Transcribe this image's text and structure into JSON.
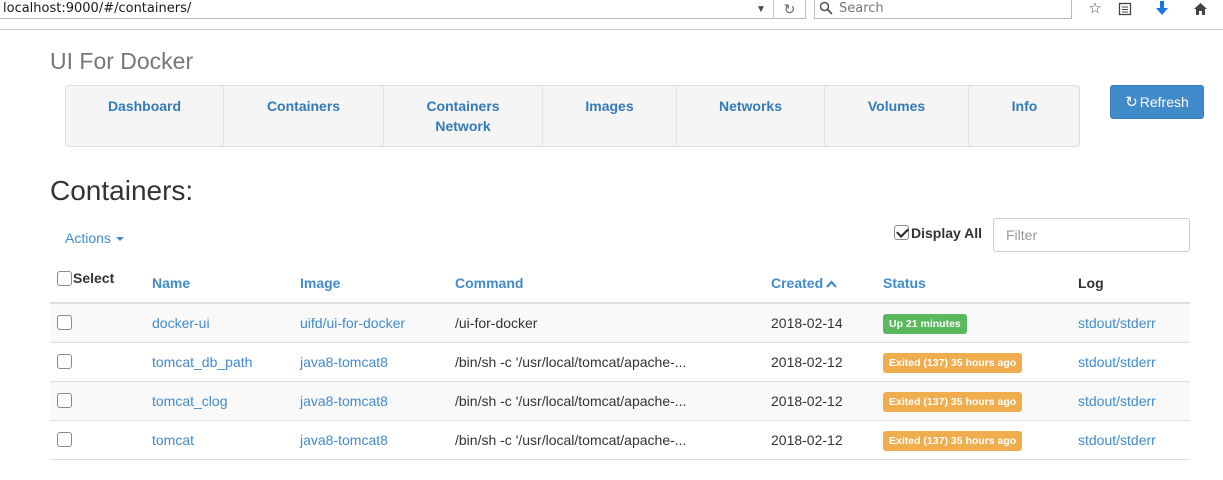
{
  "browser": {
    "url": "localhost:9000/#/containers/",
    "search_placeholder": "Search"
  },
  "app": {
    "brand": "UI For Docker"
  },
  "nav": {
    "items": [
      {
        "label": "Dashboard"
      },
      {
        "label": "Containers"
      },
      {
        "label": "Containers Network"
      },
      {
        "label": "Images"
      },
      {
        "label": "Networks"
      },
      {
        "label": "Volumes"
      },
      {
        "label": "Info"
      }
    ],
    "refresh_label": "Refresh"
  },
  "page": {
    "title": "Containers:",
    "actions_label": "Actions",
    "display_all_label": "Display All",
    "display_all_checked": true,
    "filter_placeholder": "Filter"
  },
  "table": {
    "headers": {
      "select": "Select",
      "name": "Name",
      "image": "Image",
      "command": "Command",
      "created": "Created",
      "status": "Status",
      "log": "Log"
    },
    "sorted_by": "created",
    "sort_direction": "asc",
    "rows": [
      {
        "name": "docker-ui",
        "image": "uifd/ui-for-docker",
        "command": "/ui-for-docker",
        "created": "2018-02-14",
        "status": "Up 21 minutes",
        "status_type": "up",
        "log": "stdout/stderr"
      },
      {
        "name": "tomcat_db_path",
        "image": "java8-tomcat8",
        "command": "/bin/sh -c '/usr/local/tomcat/apache-...",
        "created": "2018-02-12",
        "status": "Exited (137) 35 hours ago",
        "status_type": "exited",
        "log": "stdout/stderr"
      },
      {
        "name": "tomcat_clog",
        "image": "java8-tomcat8",
        "command": "/bin/sh -c '/usr/local/tomcat/apache-...",
        "created": "2018-02-12",
        "status": "Exited (137) 35 hours ago",
        "status_type": "exited",
        "log": "stdout/stderr"
      },
      {
        "name": "tomcat",
        "image": "java8-tomcat8",
        "command": "/bin/sh -c '/usr/local/tomcat/apache-...",
        "created": "2018-02-12",
        "status": "Exited (137) 35 hours ago",
        "status_type": "exited",
        "log": "stdout/stderr"
      }
    ]
  },
  "colors": {
    "link": "#428bca",
    "status_up": "#5cb85c",
    "status_exited": "#f0ad4e",
    "primary_button": "#428bca"
  }
}
